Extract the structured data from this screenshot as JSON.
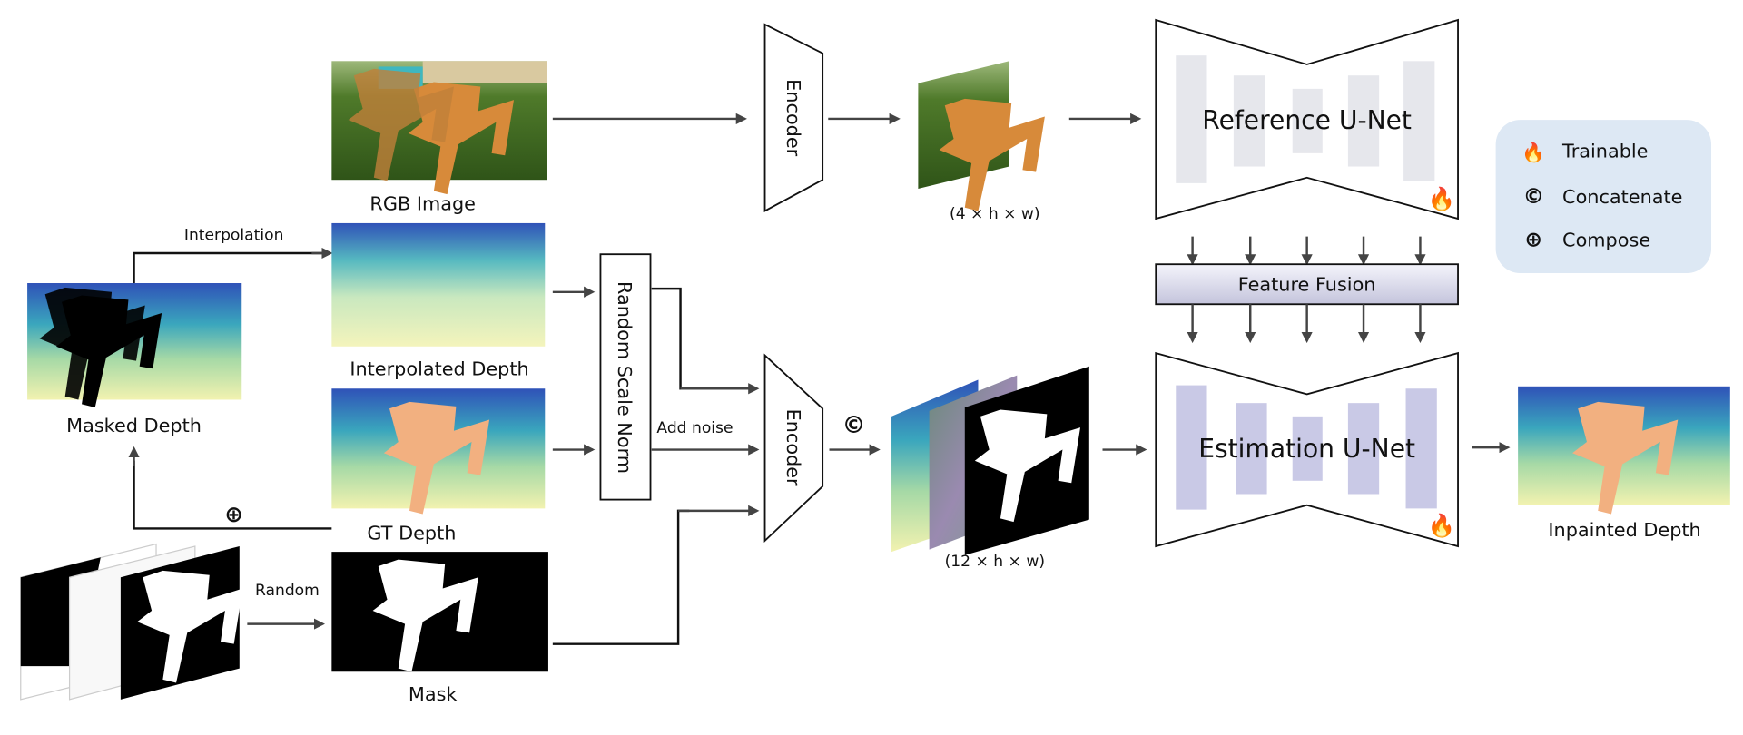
{
  "labels": {
    "rgb_image": "RGB Image",
    "masked_depth": "Masked Depth",
    "interpolated_depth": "Interpolated Depth",
    "gt_depth": "GT Depth",
    "mask": "Mask",
    "inpainted_depth": "Inpainted Depth",
    "interpolation": "Interpolation",
    "random": "Random",
    "add_noise": "Add noise",
    "random_scale_norm": "Random Scale Norm",
    "encoder_top": "Encoder",
    "encoder_bottom": "Encoder",
    "latent_top_shape": "(4 × h × w)",
    "latent_bottom_shape": "(12 × h × w)",
    "reference_unet": "Reference U-Net",
    "estimation_unet": "Estimation U-Net",
    "feature_fusion": "Feature Fusion",
    "concat_symbol": "©",
    "compose_symbol": "⊕"
  },
  "legend": {
    "items": [
      {
        "icon": "flame-icon",
        "label": "Trainable"
      },
      {
        "icon": "copyright-circle-c-icon",
        "symbol": "©",
        "label": "Concatenate"
      },
      {
        "icon": "circled-plus-icon",
        "symbol": "⊕",
        "label": "Compose"
      }
    ]
  },
  "colors": {
    "legend_bg": "#dde8f4",
    "reference_bars": "#e6e7ec",
    "estimation_bars": "#c9c9e6",
    "fusion_top": "#f4f4fb",
    "fusion_bottom": "#c4c4dc",
    "trainable_flame": "#f05a28"
  }
}
